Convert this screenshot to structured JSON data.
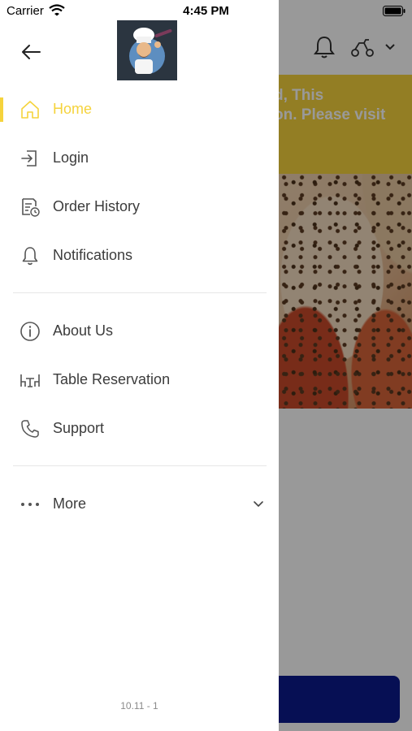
{
  "status_bar": {
    "carrier": "Carrier",
    "time": "4:45 PM"
  },
  "background": {
    "banner_text_line1": "d, This",
    "banner_text_line2": "on. Please visit",
    "banner_color": "#f5d33c",
    "button_color": "#0a1a8c"
  },
  "drawer": {
    "accent_color": "#f5d33c",
    "menu_primary": [
      {
        "label": "Home",
        "icon": "home-icon",
        "active": true
      },
      {
        "label": "Login",
        "icon": "login-icon",
        "active": false
      },
      {
        "label": "Order History",
        "icon": "order-history-icon",
        "active": false
      },
      {
        "label": "Notifications",
        "icon": "bell-icon",
        "active": false
      }
    ],
    "menu_secondary": [
      {
        "label": "About Us",
        "icon": "info-icon"
      },
      {
        "label": "Table Reservation",
        "icon": "table-icon"
      },
      {
        "label": "Support",
        "icon": "phone-icon"
      }
    ],
    "more": {
      "label": "More",
      "icon": "more-dots-icon"
    },
    "version": "10.11 - 1"
  }
}
